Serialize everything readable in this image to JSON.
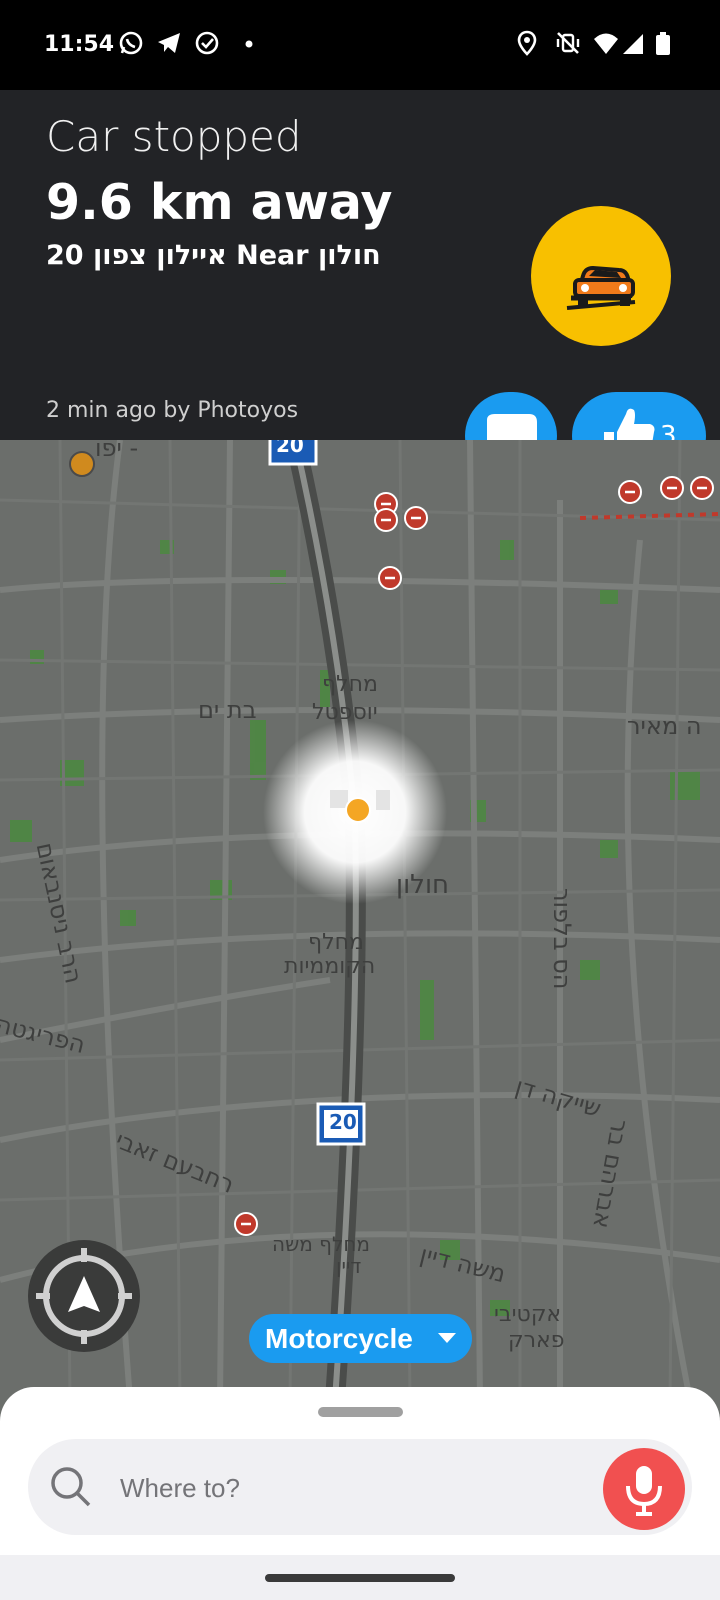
{
  "status_bar": {
    "time": "11:54",
    "left_icons": [
      "whatsapp-icon",
      "telegram-icon",
      "check-circle-icon",
      "dot-icon"
    ],
    "right_icons": [
      "location-icon",
      "vibrate-off-icon",
      "wifi-icon",
      "signal-icon",
      "battery-icon"
    ]
  },
  "alert": {
    "title": "Car stopped",
    "distance": "9.6 km away",
    "location": "20 איילון צפון Near חולון",
    "meta": "2 min ago by Photoyos",
    "badge_icon": "car-stopped-icon",
    "badge_color": "#f8c000"
  },
  "actions": {
    "chat_icon": "chat-bubble-icon",
    "thanks_icon": "thumbs-up-icon",
    "thanks_count": "3",
    "button_color": "#1a9bf0"
  },
  "map": {
    "labels": {
      "yafo": "יפו -",
      "bat_yam": "בת ים",
      "yosftal_1": "מחלף",
      "yosftal_2": "יוספטל",
      "meir": "ה מאיר",
      "nissenbaum": "הרב ניסנבאום",
      "holon": "חולון",
      "komemiyut_1": "מחלף",
      "komemiyut_2": "הקוממיות",
      "hasul": "הס בלפור",
      "frigata": "הפריגטה",
      "shaika": "שייקה דן",
      "rehavam": "רחבעם זאבי",
      "avraham": "אברהם בר",
      "moshe_dayan_interchange_1": "מחלף משה",
      "moshe_dayan_interchange_2": "דיין",
      "moshe_dayan": "משה דיין",
      "park_1": "אקטיבי",
      "park_2": "פארק",
      "highway_20": "20"
    }
  },
  "controls": {
    "recenter_icon": "recenter-arrow-icon",
    "vehicle_label": "Motorcycle",
    "vehicle_dropdown_icon": "caret-down-icon"
  },
  "bottom_sheet": {
    "search_placeholder": "Where to?",
    "search_icon": "search-icon",
    "mic_icon": "microphone-icon",
    "mic_color": "#f15050"
  }
}
